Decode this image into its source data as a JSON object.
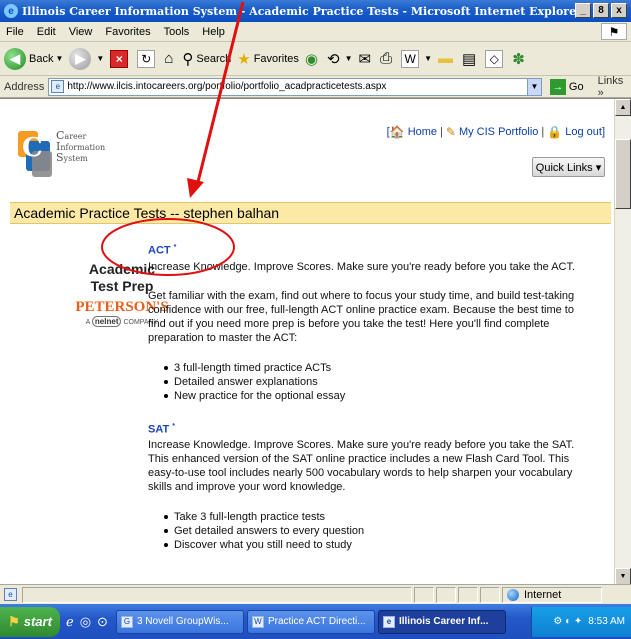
{
  "window": {
    "title": "Illinois Career Information System - Academic Practice Tests - Microsoft Internet Explorer",
    "minimize": "_",
    "maximize": "8",
    "close": "x"
  },
  "menu": [
    "File",
    "Edit",
    "View",
    "Favorites",
    "Tools",
    "Help"
  ],
  "toolbar": {
    "back_label": "Back",
    "search_label": "Search",
    "favorites_label": "Favorites"
  },
  "address": {
    "label": "Address",
    "url": "http://www.ilcis.intocareers.org/portfolio/portfolio_acadpracticetests.aspx",
    "go_label": "Go",
    "links_label": "Links »"
  },
  "logo": {
    "line1": "Career",
    "line2": "Information",
    "line3": "System"
  },
  "top_links": {
    "open_bracket": "[",
    "home": "Home",
    "portfolio": "My CIS Portfolio",
    "logout": "Log out",
    "close_bracket": "]",
    "sep": "|"
  },
  "quick_links": "Quick Links ▾",
  "page_header": "Academic Practice Tests -- stephen balhan",
  "brand": {
    "line1": "Academic",
    "line2": "Test Prep",
    "peterson": "PETERSON'S",
    "nelnet_prefix": "A",
    "nelnet": "nelnet",
    "nelnet_suffix": "COMPANY"
  },
  "sections": [
    {
      "title": "ACT",
      "mark": "*",
      "paras": [
        "Increase Knowledge. Improve Scores. Make sure you're ready before you take the ACT.",
        "Get familiar with the exam, find out where to focus your study time, and build test-taking confidence with our free, full-length ACT online practice exam. Because the best time to find out if you need more prep is before you take the test! Here you'll find complete preparation to master the ACT:"
      ],
      "bullets": [
        "3 full-length timed practice ACTs",
        "Detailed answer explanations",
        "New practice for the optional essay"
      ]
    },
    {
      "title": "SAT",
      "mark": "*",
      "paras": [
        "Increase Knowledge. Improve Scores. Make sure you're ready before you take the SAT. This enhanced version of the SAT online practice includes a new Flash Card Tool. This easy-to-use tool includes nearly 500 vocabulary words to help sharpen your vocabulary skills and improve your word knowledge."
      ],
      "bullets": [
        "Take 3 full-length practice tests",
        "Get detailed answers to every question",
        "Discover what you still need to study"
      ]
    }
  ],
  "status": {
    "zone": "Internet"
  },
  "taskbar": {
    "start": "start",
    "tasks": [
      "3 Novell GroupWis...",
      "Practice ACT Directi...",
      "Illinois Career Inf..."
    ],
    "clock": "8:53 AM"
  },
  "colors": {
    "header_bg": "#fce9a6",
    "link_blue": "#1c47b8",
    "peterson_orange": "#e86019",
    "annotation_red": "#e01010"
  }
}
